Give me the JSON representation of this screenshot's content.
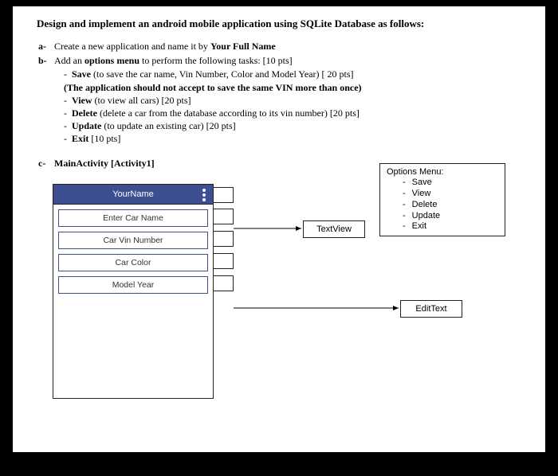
{
  "title": "Design and implement an android mobile application using SQLite Database as follows:",
  "items": {
    "a": {
      "marker": "a-",
      "pre": "Create a new application and name it by ",
      "bold": "Your Full Name"
    },
    "b": {
      "marker": "b-",
      "pre": "Add an ",
      "bold": "options menu",
      "post": " to perform the following tasks: [10 pts]",
      "sub": [
        {
          "bold": "Save",
          "rest": " (to save the car name, Vin Number, Color and Model Year) [ 20 pts]"
        },
        {
          "bold": "(The application should not accept to save the same VIN more than once)",
          "rest": ""
        },
        {
          "bold": "View",
          "rest": " (to view all cars) [20 pts]"
        },
        {
          "bold": "Delete",
          "rest": " (delete a car from the database according to its vin number) [20 pts]"
        },
        {
          "bold": "Update",
          "rest": " (to update an existing car) [20 pts]"
        },
        {
          "bold": "Exit",
          "rest": " [10 pts]"
        }
      ]
    },
    "c": {
      "marker": "c-",
      "bold": "MainActivity [Activity1]"
    }
  },
  "phone": {
    "header": "YourName",
    "fields": [
      "Enter Car Name",
      "Car Vin Number",
      "Car Color",
      "Model Year"
    ]
  },
  "boxes": {
    "options_title": "Options Menu:",
    "options_items": [
      "Save",
      "View",
      "Delete",
      "Update",
      "Exit"
    ],
    "textview": "TextView",
    "edittext": "EditText"
  }
}
